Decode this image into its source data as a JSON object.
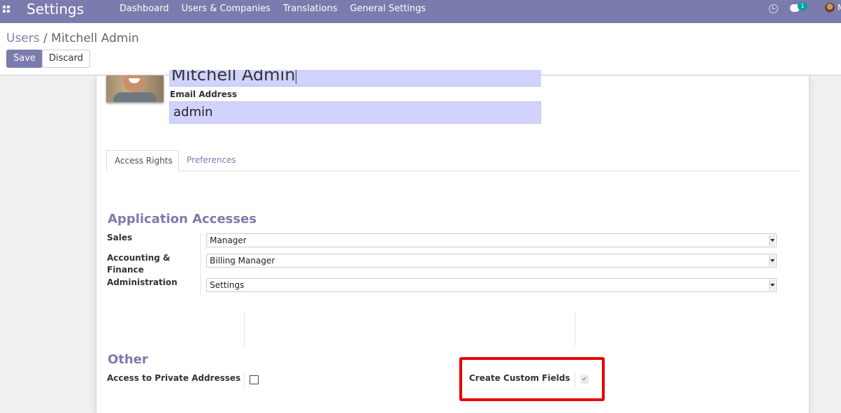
{
  "navbar": {
    "brand": "Settings",
    "menu": [
      "Dashboard",
      "Users & Companies",
      "Translations",
      "General Settings"
    ],
    "chat_badge": "1",
    "user_initial": "M"
  },
  "control_panel": {
    "breadcrumb_parent": "Users",
    "breadcrumb_separator": "/",
    "breadcrumb_current": "Mitchell Admin",
    "save_label": "Save",
    "discard_label": "Discard"
  },
  "form": {
    "name_value": "Mitchell Admin",
    "email_label": "Email Address",
    "email_value": "admin",
    "tabs": [
      "Access Rights",
      "Preferences"
    ],
    "application_accesses": {
      "title": "Application Accesses",
      "fields": [
        {
          "label": "Sales",
          "value": "Manager"
        },
        {
          "label": "Accounting & Finance",
          "value": "Billing Manager"
        },
        {
          "label": "Administration",
          "value": "Settings"
        }
      ]
    },
    "other": {
      "title": "Other",
      "private_addresses_label": "Access to Private Addresses",
      "private_addresses_checked": false,
      "custom_fields_label": "Create Custom Fields",
      "custom_fields_checked": true
    }
  },
  "colors": {
    "brand": "#7c7bad",
    "input_highlight": "#d2d2ff",
    "annotation": "#ea0000"
  }
}
